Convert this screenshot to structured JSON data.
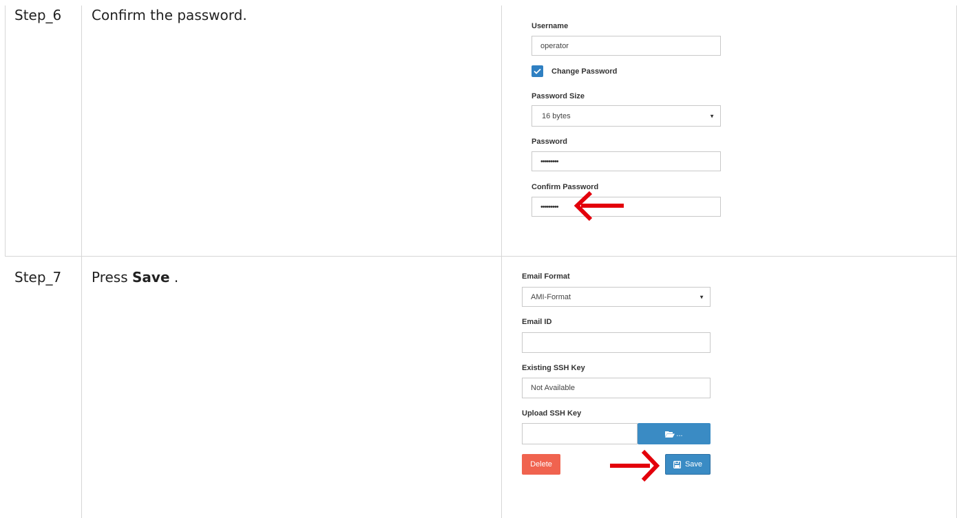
{
  "steps": [
    {
      "id": "Step_6",
      "instruction": "Confirm the password."
    },
    {
      "id": "Step_7",
      "instruction_prefix": "Press",
      "instruction_bold": "Save",
      "instruction_suffix": "."
    }
  ],
  "user_form": {
    "username_label": "Username",
    "username_value": "operator",
    "change_password_label": "Change Password",
    "change_password_checked": true,
    "password_size_label": "Password Size",
    "password_size_value": "16 bytes",
    "password_label": "Password",
    "password_mask": "•••••••••",
    "confirm_password_label": "Confirm Password",
    "confirm_password_mask": "•••••••••"
  },
  "email_form": {
    "email_format_label": "Email Format",
    "email_format_value": "AMI-Format",
    "email_id_label": "Email ID",
    "email_id_value": "",
    "existing_ssh_label": "Existing SSH Key",
    "existing_ssh_value": "Not Available",
    "upload_ssh_label": "Upload SSH Key",
    "browse_label": "...",
    "delete_label": "Delete",
    "save_label": "Save"
  },
  "colors": {
    "primary": "#3a8bc4",
    "danger": "#f0634f",
    "annotation": "#e3000b",
    "border": "#d6d6d6"
  },
  "icons": [
    "chevron-down-icon",
    "checkmark-icon",
    "folder-open-icon",
    "floppy-disk-icon",
    "arrow-left-icon",
    "arrow-right-icon"
  ]
}
